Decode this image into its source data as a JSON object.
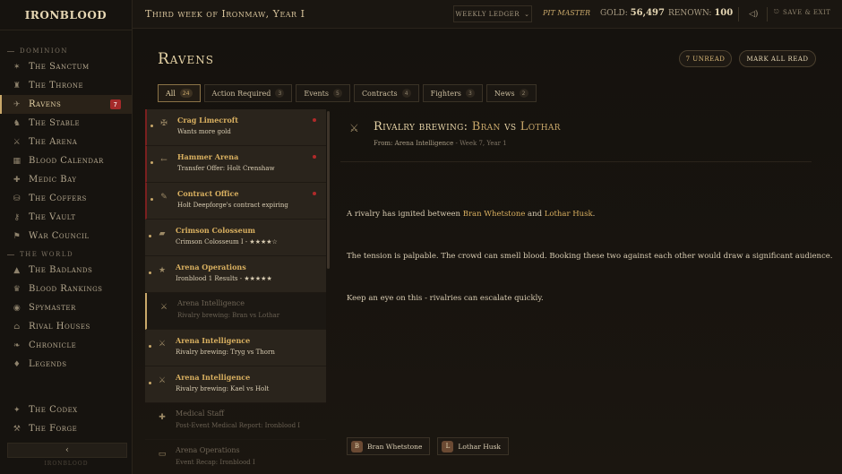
{
  "app": {
    "logo": "IRONBLOOD"
  },
  "sidebar": {
    "sections": [
      {
        "label": "DOMINION",
        "items": [
          {
            "label": "The Sanctum",
            "icon": "sanctum-icon",
            "glyph": "✶"
          },
          {
            "label": "The Throne",
            "icon": "throne-icon",
            "glyph": "♜"
          },
          {
            "label": "Ravens",
            "icon": "raven-icon",
            "glyph": "✈",
            "active": true,
            "badge": "7"
          },
          {
            "label": "The Stable",
            "icon": "stable-icon",
            "glyph": "♞"
          },
          {
            "label": "The Arena",
            "icon": "arena-icon",
            "glyph": "⚔"
          },
          {
            "label": "Blood Calendar",
            "icon": "calendar-icon",
            "glyph": "▦"
          },
          {
            "label": "Medic Bay",
            "icon": "medic-icon",
            "glyph": "✚"
          },
          {
            "label": "The Coffers",
            "icon": "coffers-icon",
            "glyph": "⛁"
          },
          {
            "label": "The Vault",
            "icon": "vault-icon",
            "glyph": "⚷"
          },
          {
            "label": "War Council",
            "icon": "council-icon",
            "glyph": "⚑"
          }
        ]
      },
      {
        "label": "THE WORLD",
        "items": [
          {
            "label": "The Badlands",
            "icon": "badlands-icon",
            "glyph": "▲"
          },
          {
            "label": "Blood Rankings",
            "icon": "rankings-icon",
            "glyph": "♛"
          },
          {
            "label": "Spymaster",
            "icon": "spymaster-icon",
            "glyph": "◉"
          },
          {
            "label": "Rival Houses",
            "icon": "houses-icon",
            "glyph": "⌂"
          },
          {
            "label": "Chronicle",
            "icon": "chronicle-icon",
            "glyph": "❧"
          },
          {
            "label": "Legends",
            "icon": "legends-icon",
            "glyph": "♦"
          }
        ]
      }
    ],
    "bottom_items": [
      {
        "label": "The Codex",
        "icon": "codex-icon",
        "glyph": "✦"
      },
      {
        "label": "The Forge",
        "icon": "forge-icon",
        "glyph": "⚒"
      }
    ],
    "collapse_glyph": "‹",
    "footer_text": "IRONBLOOD"
  },
  "topbar": {
    "week": "Third week of Ironmaw, Year I",
    "ledger": "WEEKLY LEDGER",
    "ledger_chevron": "⌄",
    "title": "PIT MASTER",
    "gold_label": "GOLD:",
    "gold_value": "56,497",
    "renown_label": "RENOWN:",
    "renown_value": "100",
    "speaker_glyph": "◁)",
    "save_exit": "SAVE & EXIT",
    "save_glyph": "⎋"
  },
  "page": {
    "title": "Ravens",
    "unread_button": "7 UNREAD",
    "mark_all_button": "MARK ALL READ"
  },
  "tabs": [
    {
      "label": "All",
      "count": "24",
      "active": true
    },
    {
      "label": "Action Required",
      "count": "3"
    },
    {
      "label": "Events",
      "count": "5"
    },
    {
      "label": "Contracts",
      "count": "4"
    },
    {
      "label": "Fighters",
      "count": "3"
    },
    {
      "label": "News",
      "count": "2"
    }
  ],
  "messages": [
    {
      "from": "Crag Limecroft",
      "subject": "Wants more gold",
      "icon": "person-icon",
      "glyph": "✠",
      "state": "unread",
      "urgent": true
    },
    {
      "from": "Hammer Arena",
      "subject": "Transfer Offer: Holt Crenshaw",
      "icon": "arrow-icon",
      "glyph": "←",
      "state": "unread",
      "urgent": true
    },
    {
      "from": "Contract Office",
      "subject": "Holt Deepforge's contract expiring",
      "icon": "quill-icon",
      "glyph": "✎",
      "state": "unread",
      "urgent": true
    },
    {
      "from": "Crimson Colosseum",
      "subject": "Crimson Colosseum I - ★★★★☆",
      "icon": "ticket-icon",
      "glyph": "▰",
      "state": "unread"
    },
    {
      "from": "Arena Operations",
      "subject": "Ironblood 1 Results - ★★★★★",
      "icon": "star-icon",
      "glyph": "★",
      "state": "unread"
    },
    {
      "from": "Arena Intelligence",
      "subject": "Rivalry brewing: Bran vs Lothar",
      "icon": "versus-icon",
      "glyph": "⚔",
      "state": "selected"
    },
    {
      "from": "Arena Intelligence",
      "subject": "Rivalry brewing: Tryg vs Thorn",
      "icon": "versus-icon",
      "glyph": "⚔",
      "state": "unread"
    },
    {
      "from": "Arena Intelligence",
      "subject": "Rivalry brewing: Kael vs Holt",
      "icon": "versus-icon",
      "glyph": "⚔",
      "state": "unread"
    },
    {
      "from": "Medical Staff",
      "subject": "Post-Event Medical Report: Ironblood I",
      "icon": "medical-icon",
      "glyph": "✚",
      "state": "read"
    },
    {
      "from": "Arena Operations",
      "subject": "Event Recap: Ironblood I",
      "icon": "recap-icon",
      "glyph": "▭",
      "state": "read"
    }
  ],
  "detail": {
    "icon_glyph": "⚔",
    "title_prefix": "Rivalry brewing: ",
    "title_a": "Bran",
    "title_vs": " vs ",
    "title_b": "Lothar",
    "from_label": "From: Arena Intelligence",
    "meta_sep": " - ",
    "date": "Week 7, Year 1",
    "p1_pre": "A rivalry has ignited between ",
    "p1_a": "Bran Whetstone",
    "p1_mid": " and ",
    "p1_b": "Lothar Husk",
    "p1_post": ".",
    "p2": "The tension is palpable. The crowd can smell blood. Booking these two against each other would draw a significant audience.",
    "p3": "Keep an eye on this - rivalries can escalate quickly.",
    "tags": [
      {
        "name": "Bran Whetstone",
        "initial": "B"
      },
      {
        "name": "Lothar Husk",
        "initial": "L"
      }
    ]
  }
}
